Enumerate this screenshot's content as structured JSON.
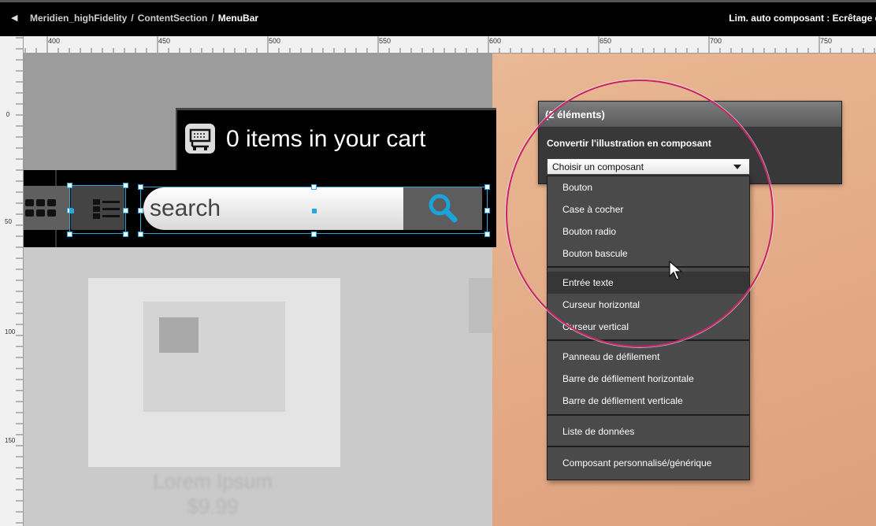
{
  "breadcrumb": {
    "back_icon": "back-arrow-icon",
    "items": [
      "Meridien_highFidelity",
      "ContentSection",
      "MenuBar"
    ],
    "separator": "/",
    "clip_text": "Lim. auto composant : Ecrêtage désa"
  },
  "ruler": {
    "h_labels": [
      "400",
      "450",
      "500",
      "550",
      "600",
      "650",
      "700",
      "750"
    ],
    "v_labels": [
      "0",
      "50",
      "100",
      "150"
    ]
  },
  "cart": {
    "icon": "cart-icon",
    "text": "0 items in your cart"
  },
  "menubar": {
    "grid_view_icon": "grid-view-icon",
    "list_view_icon": "list-view-icon",
    "search_placeholder": "search",
    "search_icon": "search-icon"
  },
  "background_card": {
    "title": "Lorem Ipsum",
    "price": "$9.99"
  },
  "panel": {
    "header": "(2 éléments)",
    "label": "Convertir l'illustration en composant",
    "select_value": "Choisir un composant",
    "options": [
      "Bouton",
      "Case à cocher",
      "Bouton radio",
      "Bouton bascule",
      "Entrée texte",
      "Curseur horizontal",
      "Curseur vertical",
      "Panneau de défilement",
      "Barre de défilement horizontale",
      "Barre de défilement verticale",
      "Liste de données",
      "Composant personnalisé/générique"
    ],
    "highlighted_option": "Entrée texte"
  },
  "colors": {
    "selection": "#27a7e0",
    "circle": "#c7246a",
    "artboard_bg": "#e3a985"
  }
}
